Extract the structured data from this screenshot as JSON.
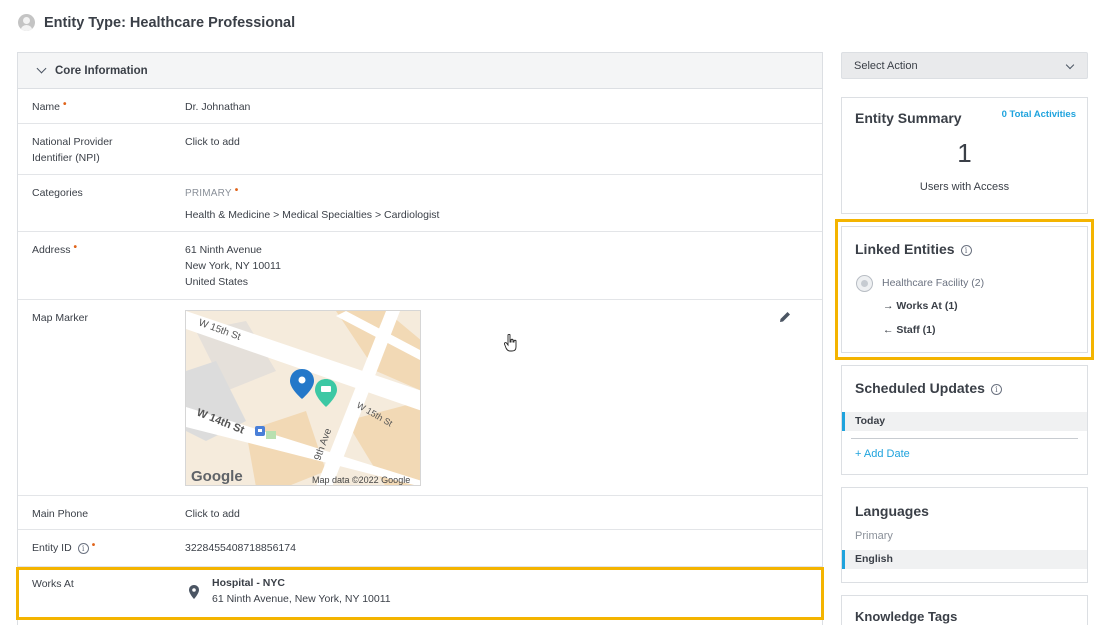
{
  "header": {
    "title": "Entity Type: Healthcare Professional"
  },
  "core": {
    "section_title": "Core Information",
    "fields": {
      "name": {
        "label": "Name",
        "value": "Dr. Johnathan"
      },
      "npi": {
        "label_line1": "National Provider",
        "label_line2": "Identifier (NPI)",
        "placeholder": "Click to add"
      },
      "categories": {
        "label": "Categories",
        "tag": "PRIMARY",
        "value": "Health & Medicine > Medical Specialties > Cardiologist"
      },
      "address": {
        "label": "Address",
        "line1": "61 Ninth Avenue",
        "line2": "New York, NY 10011",
        "line3": "United States"
      },
      "map_marker": {
        "label": "Map Marker",
        "streets": {
          "s1": "W 15th St",
          "s2": "W 14th St",
          "s3": "9th Ave",
          "s4": "W 15th St"
        },
        "google": "Google",
        "attribution": "Map data ©2022 Google"
      },
      "main_phone": {
        "label": "Main Phone",
        "placeholder": "Click to add"
      },
      "entity_id": {
        "label": "Entity ID",
        "value": "3228455408718856174"
      },
      "works_at": {
        "label": "Works At",
        "name": "Hospital - NYC",
        "address": "61 Ninth Avenue, New York, NY 10011"
      }
    }
  },
  "sidebar": {
    "select_action": "Select Action",
    "summary": {
      "title": "Entity Summary",
      "activities_link": "0 Total Activities",
      "count": "1",
      "count_label": "Users with Access"
    },
    "linked": {
      "title": "Linked Entities",
      "group": "Healthcare Facility (2)",
      "works_at": "Works At (1)",
      "staff": "Staff (1)",
      "arrow_right": "→",
      "arrow_left": "←"
    },
    "scheduled": {
      "title": "Scheduled Updates",
      "today": "Today",
      "add_date": "+ Add Date"
    },
    "languages": {
      "title": "Languages",
      "primary_label": "Primary",
      "primary_value": "English"
    },
    "knowledge": {
      "title": "Knowledge Tags"
    },
    "info_glyph": "i"
  },
  "colors": {
    "accent": "#1fa3dd",
    "highlight": "#f4b400",
    "required": "#e0641b"
  }
}
